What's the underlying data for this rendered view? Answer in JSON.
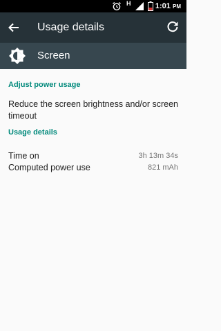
{
  "status_bar": {
    "time": "1:01",
    "ampm": "PM",
    "network_label": "H",
    "icons": [
      "alarm-icon",
      "network-h-icon",
      "signal-icon",
      "battery-icon"
    ]
  },
  "toolbar": {
    "title": "Usage details",
    "back_icon": "arrow-left-icon",
    "refresh_icon": "refresh-icon"
  },
  "header": {
    "icon": "brightness-icon",
    "label": "Screen"
  },
  "sections": {
    "adjust_title": "Adjust power usage",
    "adjust_item": "Reduce the screen brightness and/or screen timeout",
    "usage_title": "Usage details"
  },
  "usage": {
    "time_on_label": "Time on",
    "time_on_value": "3h 13m 34s",
    "power_label": "Computed power use",
    "power_value": "821 mAh"
  },
  "colors": {
    "toolbar_bg": "#263238",
    "header_bg": "#37474f",
    "accent": "#00897b",
    "battery": "#d32f2f"
  }
}
